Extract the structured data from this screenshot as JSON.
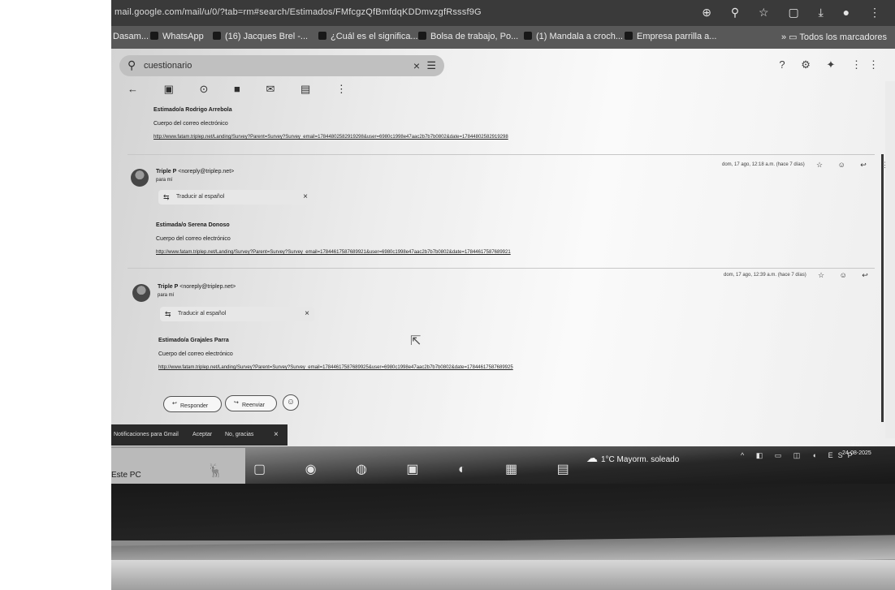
{
  "browser": {
    "url": "mail.google.com/mail/u/0/?tab=rm#search/Estimados/FMfcgzQfBmfdqKDDmvzgfRsssf9G",
    "bookmarks": [
      {
        "label": "Dasam..."
      },
      {
        "label": "WhatsApp"
      },
      {
        "label": "(16) Jacques Brel -..."
      },
      {
        "label": "¿Cuál es el significa..."
      },
      {
        "label": "Bolsa de trabajo, Po..."
      },
      {
        "label": "(1) Mandala a croch..."
      },
      {
        "label": "Empresa parrilla a..."
      }
    ],
    "all_bookmarks": "Todos los marcadores"
  },
  "gmail": {
    "search_query": "cuestionario",
    "messages": [
      {
        "greeting": "Estimado/a Rodrigo Arrebola",
        "body": "Cuerpo del correo electrónico",
        "link": "http://www.fatam.triplep.net/Landing/Survey?Parent=Survey?Survey_email=17844802582919298&user=6980c1998e47aac2b7b7b0802&date=17844802582919298"
      },
      {
        "sender": "Triple P",
        "sender_email": "<noreply@triplep.net>",
        "to": "para mí",
        "date": "dom, 17 ago, 12:18 a.m. (hace 7 días)",
        "translate": "Traducir al español",
        "greeting": "Estimada/o Serena Donoso",
        "body": "Cuerpo del correo electrónico",
        "link": "http://www.fatam.triplep.net/Landing/Survey?Parent=Survey?Survey_email=17844617587689921&user=6980c1998e47aac2b7b7b0802&date=17844617587689921"
      },
      {
        "sender": "Triple P",
        "sender_email": "<noreply@triplep.net>",
        "to": "para mí",
        "date": "dom, 17 ago, 12:39 a.m. (hace 7 días)",
        "translate": "Traducir al español",
        "greeting": "Estimado/a Grajales Parra",
        "body": "Cuerpo del correo electrónico",
        "link": "http://www.fatam.triplep.net/Landing/Survey?Parent=Survey?Survey_email=17844617587689925&user=6980c1998e47aac2b7b7b0802&date=17844617587689925"
      }
    ],
    "reply_label": "Responder",
    "forward_label": "Reenviar"
  },
  "snackbar": {
    "text": "Notificaciones para Gmail",
    "allow": "Aceptar",
    "deny": "No, gracias",
    "close": "×"
  },
  "taskbar": {
    "desk_label": "Este PC",
    "weather": "1°C  Mayorm. soleado",
    "time": "9:07",
    "date": "24-08-2025",
    "lang": "ESP"
  }
}
